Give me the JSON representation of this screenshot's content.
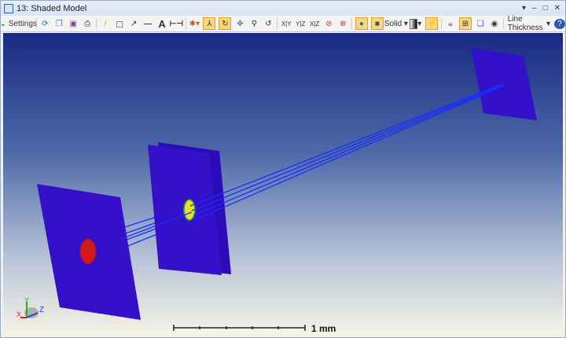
{
  "window": {
    "title": "13: Shaded Model",
    "controls": [
      "▾",
      "–",
      "□",
      "✕"
    ]
  },
  "toolbar": {
    "settings": "Settings",
    "solid": "Solid",
    "line_thickness": "Line Thickness",
    "axis_buttons": [
      "X|Y",
      "Y|Z",
      "X|Z"
    ],
    "icons": [
      "refresh-icon",
      "copy-icon",
      "save-icon",
      "print-icon",
      "pencil-icon",
      "rectangle-icon",
      "arrow-icon",
      "line-icon",
      "text-icon",
      "dimension-icon",
      "light-icon",
      "axes-icon",
      "rotate-icon",
      "pan-icon",
      "zoom-icon",
      "reset-icon",
      "no-rays-icon",
      "no-surface-icon",
      "shade-icon",
      "box-icon",
      "gradient-icon",
      "flashlight-icon",
      "lock-icon",
      "fit-icon",
      "window-icon",
      "refresh-circle-icon",
      "help-icon"
    ]
  },
  "view": {
    "scale_label": "1 mm",
    "axes": {
      "x": "X",
      "y": "Y",
      "z": "Z"
    },
    "colors": {
      "plane": "#3410c8",
      "ray": "#1a2cff",
      "spot_left": "#d21818",
      "spot_mid": "#e8e020"
    }
  }
}
